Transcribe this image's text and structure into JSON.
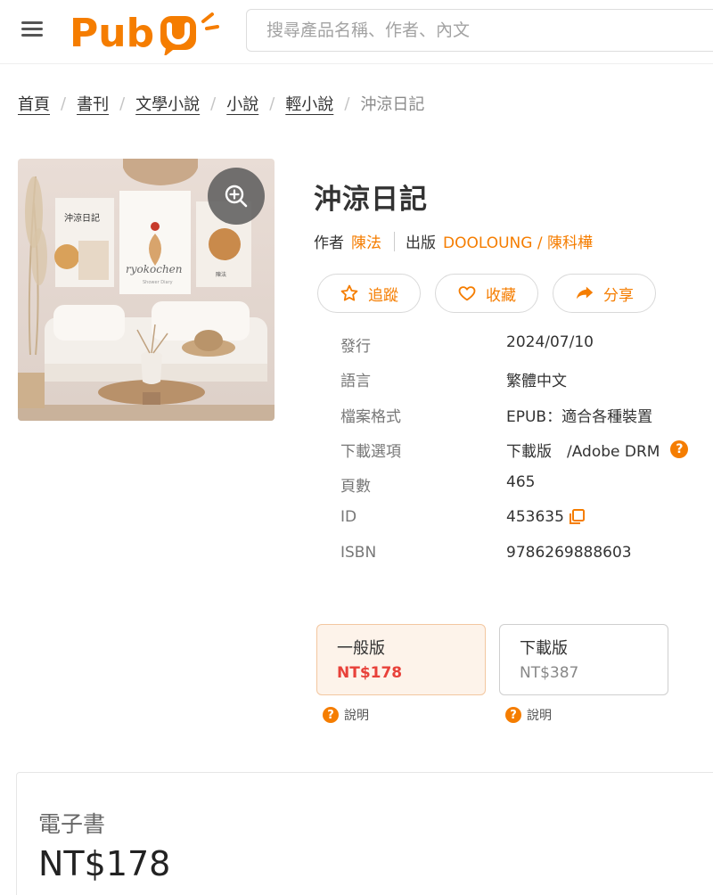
{
  "header": {
    "logo_text": "Pubu",
    "search_placeholder": "搜尋產品名稱、作者、內文"
  },
  "breadcrumb": {
    "items": [
      "首頁",
      "書刊",
      "文學小說",
      "小說",
      "輕小說"
    ],
    "current": "沖涼日記"
  },
  "cover": {
    "poster_title": "沖涼日記",
    "poster_center": "ryokochen",
    "poster_center_sub": "Shower Diary",
    "poster_right": "陳法"
  },
  "book": {
    "title": "沖涼日記",
    "author_label": "作者",
    "author": "陳法",
    "publisher_label": "出版",
    "publisher": "DOOLOUNG / 陳科樺"
  },
  "actions": {
    "follow": "追蹤",
    "favorite": "收藏",
    "share": "分享"
  },
  "specs": [
    {
      "key": "發行",
      "value": "2024/07/10"
    },
    {
      "key": "語言",
      "value": "繁體中文"
    },
    {
      "key": "檔案格式",
      "value": "EPUB：適合各種裝置"
    },
    {
      "key": "下載選項",
      "value": "下載版　/Adobe DRM"
    },
    {
      "key": "頁數",
      "value": "465"
    },
    {
      "key": "ID",
      "value": "453635"
    },
    {
      "key": "ISBN",
      "value": "9786269888603"
    }
  ],
  "editions": [
    {
      "label": "一般版",
      "price": "NT$178",
      "explain": "說明"
    },
    {
      "label": "下載版",
      "price": "NT$387",
      "explain": "說明"
    }
  ],
  "ebook": {
    "label": "電子書",
    "price": "NT$178"
  },
  "colors": {
    "accent": "#f57d00",
    "price_red": "#e8413a"
  }
}
